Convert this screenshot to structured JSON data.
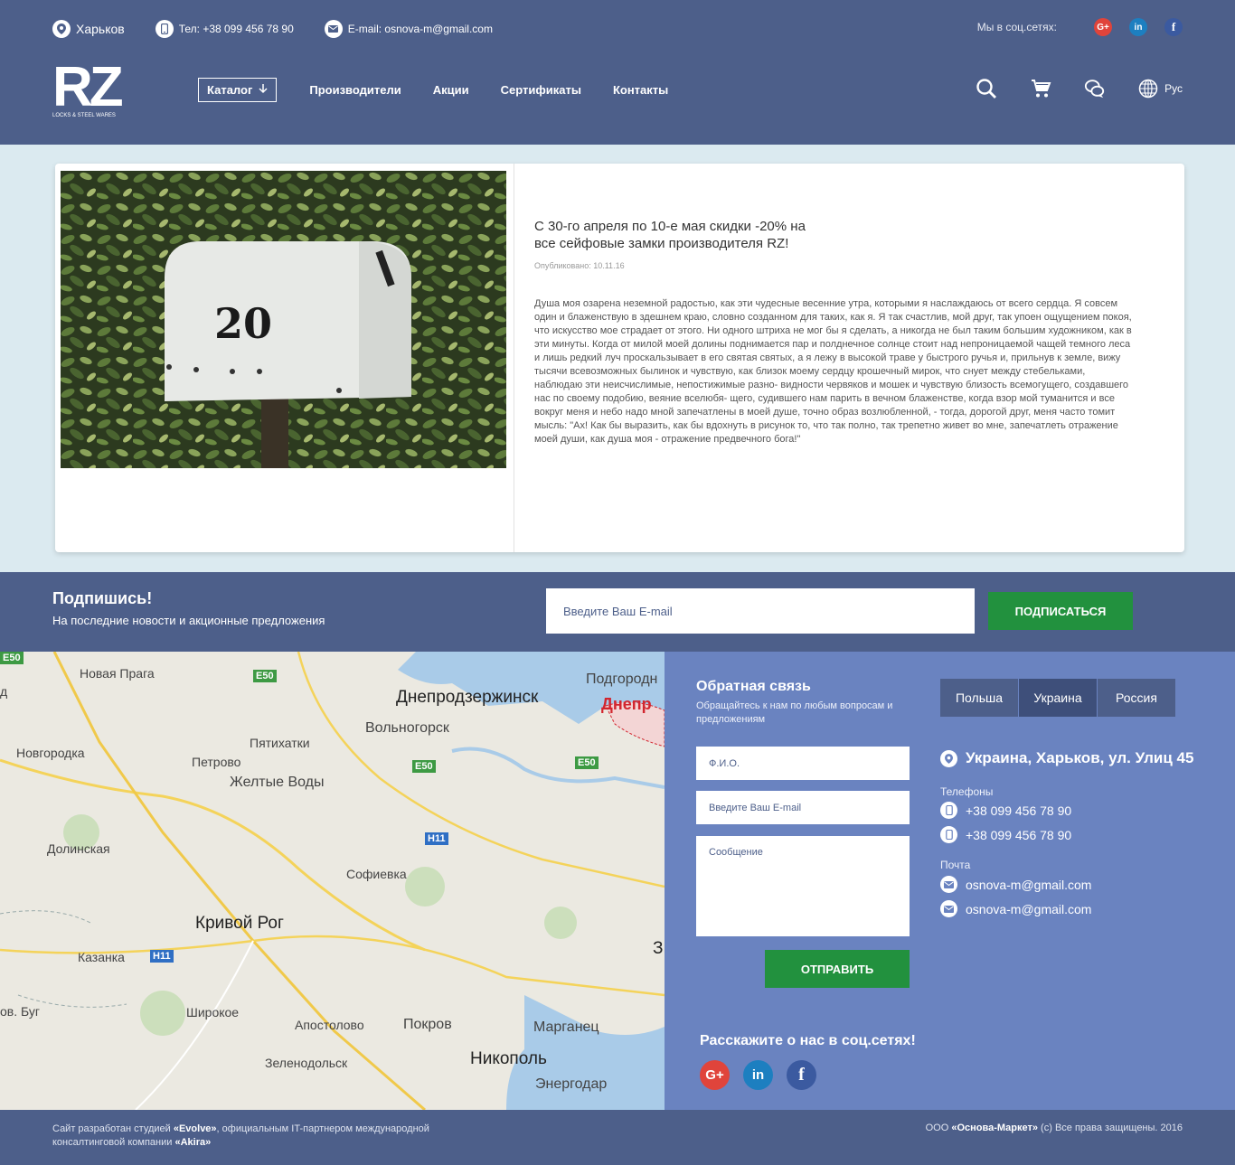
{
  "topbar": {
    "city": "Харьков",
    "phone": "Тел: +38 099 456 78 90",
    "email": "E-mail: osnova-m@gmail.com",
    "social_label": "Мы в соц.сетях:",
    "social": [
      "G+",
      "in",
      "f"
    ]
  },
  "logo": {
    "mark": "RZ",
    "subtitle": "LOCKS & STEEL WARES"
  },
  "nav": {
    "catalog": "Каталог",
    "links": [
      "Производители",
      "Акции",
      "Сертификаты",
      "Контакты"
    ],
    "language": "Рус"
  },
  "article": {
    "title": "С 30-го апреля по 10-е мая скидки -20% на все сейфовые замки производителя RZ!",
    "date": "Опубликовано: 10.11.16",
    "body": "Душа моя озарена неземной радостью, как эти чудесные весенние утра, которыми я наслаждаюсь от всего сердца. Я совсем один и блаженствую в здешнем краю, словно созданном для таких, как я. Я так счастлив, мой друг, так упоен ощущением покоя, что искусство мое страдает от этого. Ни одного штриха не мог бы я сделать, а никогда не был таким большим художником, как в эти минуты. Когда от милой моей долины поднимается пар и полднечное солнце стоит над непроницаемой чащей темного леса и лишь редкий луч проскальзывает в его святая святых, а я лежу в высокой траве у быстрого ручья и, прильнув к земле, вижу тысячи всевозможных былинок и чувствую, как близок моему сердцу крошечный мирок, что снует между стебельками, наблюдаю эти неисчислимые, непостижимые разно- видности червяков и мошек и чувствую близость всемогущего, создавшего нас по своему подобию, веяние вселюбя- щего, судившего нам парить в вечном блаженстве, когда взор мой туманится и все вокруг меня и небо надо мной запечатлены в моей душе, точно образ возлюбленной, - тогда, дорогой друг, меня часто томит мысль: \"Ах! Как бы выразить, как бы вдохнуть в рисунок то, что так полно, так трепетно живет во мне, запечатлеть отражение моей души, как душа моя - отражение предвечного бога!\"",
    "mailbox_number": "20"
  },
  "subscribe": {
    "title": "Подпишись!",
    "text": "На последние новости и акционные предложения",
    "placeholder": "Введите Ваш E-mail",
    "button": "ПОДПИСАТЬСЯ"
  },
  "map": {
    "places": [
      "Новая Прага",
      "Подгородн",
      "Днепродзержинск",
      "Днепр",
      "Вольногорск",
      "Новгородка",
      "Пятихатки",
      "Петрово",
      "Желтые Воды",
      "Долинская",
      "Софиевка",
      "Кривой Рог",
      "Казанка",
      "ов. Буг",
      "Широкое",
      "Апостолово",
      "Покров",
      "Марганец",
      "Зеленодольск",
      "Никополь",
      "Энергодар",
      "д",
      "З"
    ],
    "roads": [
      "E50",
      "E50",
      "E50",
      "E50",
      "H11",
      "H11"
    ]
  },
  "feedback": {
    "title": "Обратная связь",
    "subtitle": "Обращайтесь к нам по любым вопросам и предложениям",
    "fio_placeholder": "Ф.И.О.",
    "email_placeholder": "Введите Ваш E-mail",
    "message_placeholder": "Сообщение",
    "send": "ОТПРАВИТЬ"
  },
  "contacts": {
    "tabs": [
      "Польша",
      "Украина",
      "Россия"
    ],
    "active_tab": "Украина",
    "address": "Украина, Харьков, ул. Улиц 45",
    "phones_label": "Телефоны",
    "phones": [
      "+38 099 456 78 90",
      "+38 099 456 78 90"
    ],
    "mail_label": "Почта",
    "emails": [
      "osnova-m@gmail.com",
      "osnova-m@gmail.com"
    ]
  },
  "share": {
    "title": "Расскажите о нас в соц.сетях!"
  },
  "footer": {
    "left_1": "Сайт разработан студией ",
    "left_evolve": "«Evolve»",
    "left_2": ", официальным IT-партнером международной консалтинговой компании ",
    "left_akira": "«Akira»",
    "right_1": "ООО ",
    "right_company": "«Основа-Маркет»",
    "right_2": " (c) Все права защищены. 2016"
  },
  "colors": {
    "header": "#4d5f8a",
    "contact_bg": "#6a83c0",
    "button_green": "#22913e",
    "page_bg": "#dbeaf0"
  }
}
